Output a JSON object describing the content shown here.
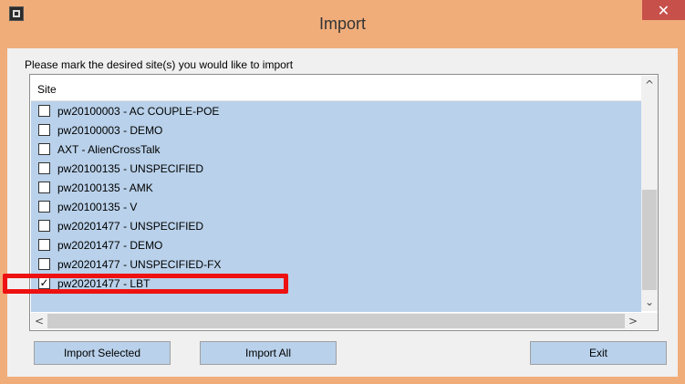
{
  "window": {
    "title": "Import",
    "close_glyph": "✕",
    "accent_color": "#f0ad7a",
    "close_color": "#c7504b",
    "icon": "app-icon"
  },
  "dialog": {
    "prompt": "Please mark the desired site(s) you would like to import",
    "list": {
      "header": "Site",
      "selection_color": "#b9d1ea",
      "items": [
        {
          "label": "pw20100003 - AC COUPLE-POE",
          "checked": false
        },
        {
          "label": "pw20100003 - DEMO",
          "checked": false
        },
        {
          "label": "AXT - AlienCrossTalk",
          "checked": false
        },
        {
          "label": "pw20100135 - UNSPECIFIED",
          "checked": false
        },
        {
          "label": "pw20100135 - AMK",
          "checked": false
        },
        {
          "label": "pw20100135 - V",
          "checked": false
        },
        {
          "label": "pw20201477 - UNSPECIFIED",
          "checked": false
        },
        {
          "label": "pw20201477 - DEMO",
          "checked": false
        },
        {
          "label": "pw20201477 - UNSPECIFIED-FX",
          "checked": false
        },
        {
          "label": "pw20201477 - LBT",
          "checked": true
        }
      ]
    },
    "scroll_glyphs": {
      "up": "^",
      "down": "⌄",
      "left": "<",
      "right": ">"
    },
    "buttons": {
      "import_selected": "Import Selected",
      "import_all": "Import All",
      "exit": "Exit"
    }
  },
  "annotation": {
    "highlight_color": "#ee1111"
  }
}
